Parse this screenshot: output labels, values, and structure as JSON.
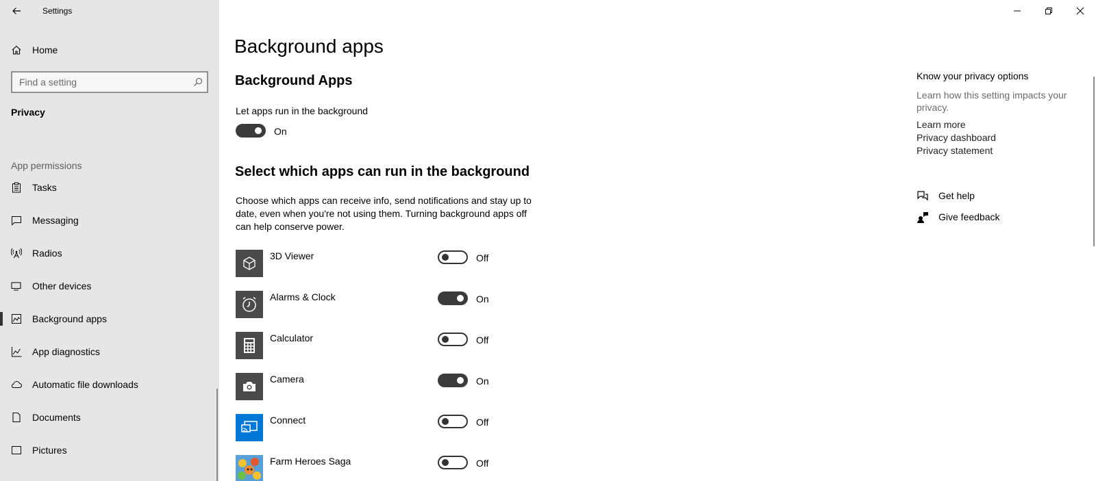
{
  "window": {
    "title": "Settings"
  },
  "sidebar": {
    "home_label": "Home",
    "search_placeholder": "Find a setting",
    "section_title": "Privacy",
    "group_label": "App permissions",
    "items": [
      {
        "label": "Tasks",
        "icon": "clipboard-icon"
      },
      {
        "label": "Messaging",
        "icon": "message-icon"
      },
      {
        "label": "Radios",
        "icon": "radio-tower-icon"
      },
      {
        "label": "Other devices",
        "icon": "devices-icon"
      },
      {
        "label": "Background apps",
        "icon": "background-apps-icon",
        "selected": true
      },
      {
        "label": "App diagnostics",
        "icon": "diagnostics-icon"
      },
      {
        "label": "Automatic file downloads",
        "icon": "cloud-icon"
      },
      {
        "label": "Documents",
        "icon": "document-icon"
      },
      {
        "label": "Pictures",
        "icon": "picture-icon"
      }
    ]
  },
  "main": {
    "page_title": "Background apps",
    "sub_title": "Background Apps",
    "let_apps_label": "Let apps run in the background",
    "let_apps_state": "On",
    "select_title": "Select which apps can run in the background",
    "description": "Choose which apps can receive info, send notifications and stay up to date, even when you're not using them. Turning background apps off can help conserve power.",
    "apps": [
      {
        "name": "3D Viewer",
        "state": "Off",
        "on": false,
        "tile_color": "#4a4a4a",
        "icon": "cube-icon"
      },
      {
        "name": "Alarms & Clock",
        "state": "On",
        "on": true,
        "tile_color": "#4a4a4a",
        "icon": "alarm-clock-icon"
      },
      {
        "name": "Calculator",
        "state": "Off",
        "on": false,
        "tile_color": "#4a4a4a",
        "icon": "calculator-icon"
      },
      {
        "name": "Camera",
        "state": "On",
        "on": true,
        "tile_color": "#4a4a4a",
        "icon": "camera-icon"
      },
      {
        "name": "Connect",
        "state": "Off",
        "on": false,
        "tile_color": "#0078d7",
        "icon": "connect-icon"
      },
      {
        "name": "Farm Heroes Saga",
        "state": "Off",
        "on": false,
        "tile_color": "#5aa0d8",
        "icon": "game-icon"
      }
    ]
  },
  "right": {
    "title": "Know your privacy options",
    "description": "Learn how this setting impacts your privacy.",
    "links": [
      "Learn more",
      "Privacy dashboard",
      "Privacy statement"
    ],
    "get_help": "Get help",
    "give_feedback": "Give feedback"
  }
}
